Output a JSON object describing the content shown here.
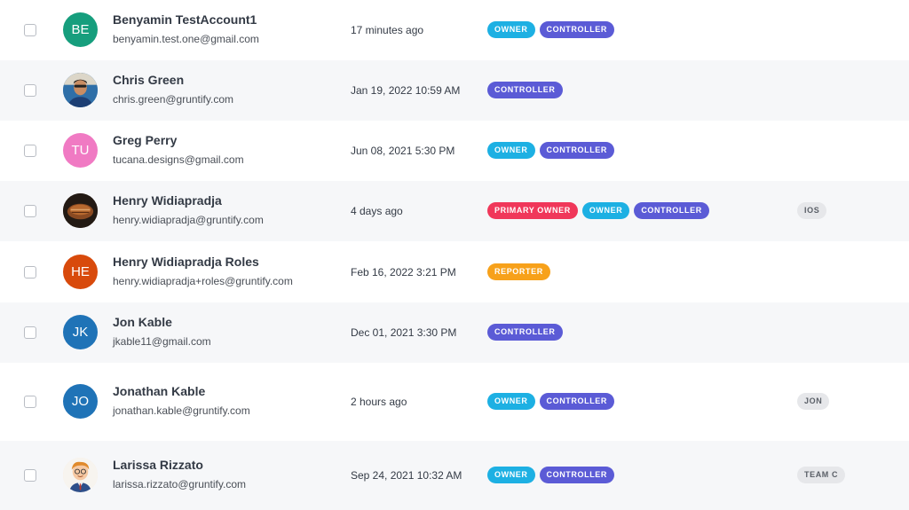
{
  "colors": {
    "owner": "#1db0e3",
    "controller": "#5b5bd6",
    "primary_owner": "#f0375a",
    "reporter": "#f7a11a",
    "team_tag_bg": "#e6e7ea",
    "row_alt_bg": "#f6f7f9"
  },
  "users": [
    {
      "name": "Benyamin TestAccount1",
      "email": "benyamin.test.one@gmail.com",
      "last_active": "17 minutes ago",
      "avatar": {
        "initials": "BE",
        "color": "#169e7d",
        "icon": "initials-avatar"
      },
      "roles": [
        "OWNER",
        "CONTROLLER"
      ],
      "team": ""
    },
    {
      "name": "Chris Green",
      "email": "chris.green@gruntify.com",
      "last_active": "Jan 19, 2022 10:59 AM",
      "avatar": {
        "initials": "",
        "color": "#2f6fa8",
        "icon": "person-photo-avatar"
      },
      "roles": [
        "CONTROLLER"
      ],
      "team": ""
    },
    {
      "name": "Greg Perry",
      "email": "tucana.designs@gmail.com",
      "last_active": "Jun 08, 2021 5:30 PM",
      "avatar": {
        "initials": "TU",
        "color": "#f07ac3",
        "icon": "initials-avatar"
      },
      "roles": [
        "OWNER",
        "CONTROLLER"
      ],
      "team": ""
    },
    {
      "name": "Henry Widiapradja",
      "email": "henry.widiapradja@gruntify.com",
      "last_active": "4 days ago",
      "avatar": {
        "initials": "",
        "color": "#3a2a22",
        "icon": "food-photo-avatar"
      },
      "roles": [
        "PRIMARY OWNER",
        "OWNER",
        "CONTROLLER"
      ],
      "team": "IOS"
    },
    {
      "name": "Henry Widiapradja Roles",
      "email": "henry.widiapradja+roles@gruntify.com",
      "last_active": "Feb 16, 2022 3:21 PM",
      "avatar": {
        "initials": "HE",
        "color": "#d84a0c",
        "icon": "initials-avatar"
      },
      "roles": [
        "REPORTER"
      ],
      "team": ""
    },
    {
      "name": "Jon Kable",
      "email": "jkable11@gmail.com",
      "last_active": "Dec 01, 2021 3:30 PM",
      "avatar": {
        "initials": "JK",
        "color": "#1f73b7",
        "icon": "initials-avatar"
      },
      "roles": [
        "CONTROLLER"
      ],
      "team": ""
    },
    {
      "name": "Jonathan Kable",
      "email": "jonathan.kable@gruntify.com",
      "last_active": "2 hours ago",
      "avatar": {
        "initials": "JO",
        "color": "#1f73b7",
        "icon": "initials-avatar"
      },
      "roles": [
        "OWNER",
        "CONTROLLER"
      ],
      "team": "JON"
    },
    {
      "name": "Larissa Rizzato",
      "email": "larissa.rizzato@gruntify.com",
      "last_active": "Sep 24, 2021 10:32 AM",
      "avatar": {
        "initials": "",
        "color": "#fde7cf",
        "icon": "cartoon-person-avatar"
      },
      "roles": [
        "OWNER",
        "CONTROLLER"
      ],
      "team": "TEAM C"
    }
  ]
}
